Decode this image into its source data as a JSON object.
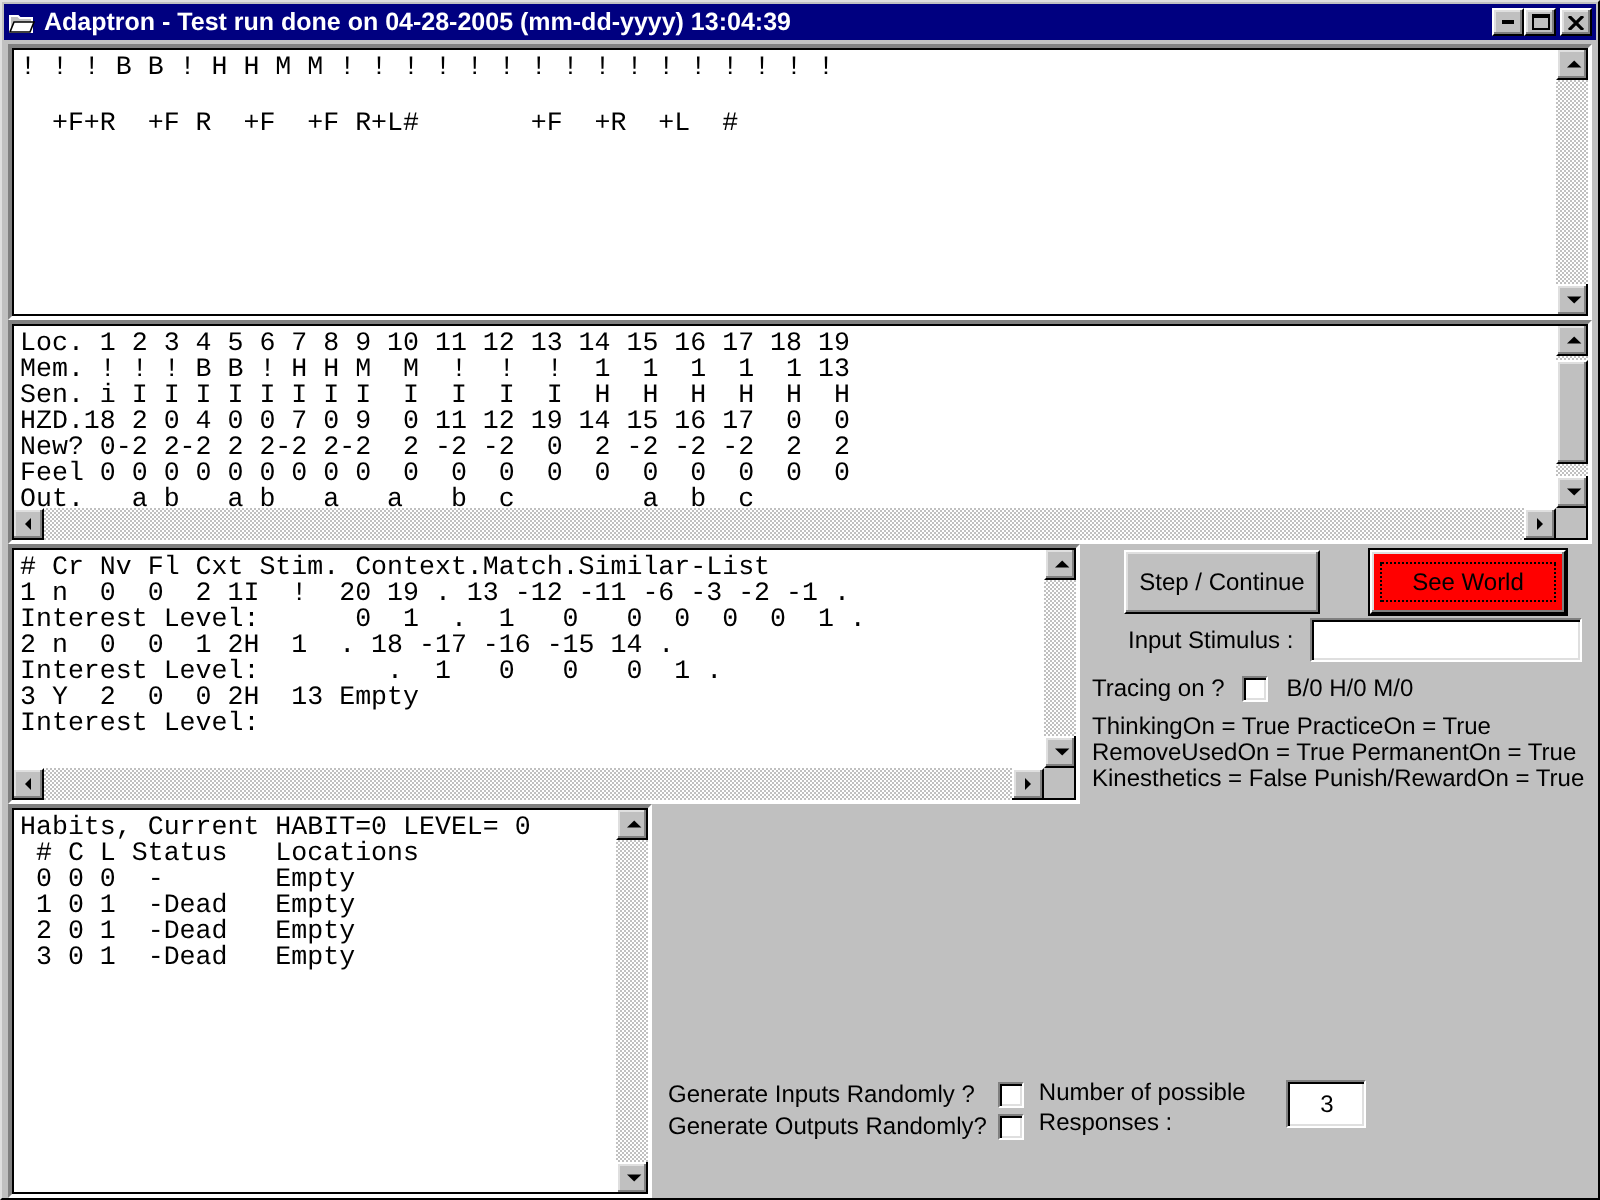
{
  "window": {
    "title": "Adaptron - Test run done on 04-28-2005 (mm-dd-yyyy) 13:04:39"
  },
  "stimulus_pane": {
    "lines": [
      "! ! ! B B ! H H M M ! ! ! ! ! ! ! ! ! ! ! ! ! ! ! !",
      "  +F+R  +F R  +F  +F R+L#       +F  +R  +L  #"
    ]
  },
  "memory_table": {
    "lines": [
      "Loc. 1 2 3 4 5 6 7 8 9 10 11 12 13 14 15 16 17 18 19",
      "Mem. ! ! ! B B ! H H M  M  !  !  !  1  1  1  1  1 13",
      "Sen. i I I I I I I I I  I  I  I  I  H  H  H  H  H  H",
      "HZD.18 2 0 4 0 0 7 0 9  0 11 12 19 14 15 16 17  0  0",
      "New? 0-2 2-2 2 2-2 2-2  2 -2 -2  0  2 -2 -2 -2  2  2",
      "Feel 0 0 0 0 0 0 0 0 0  0  0  0  0  0  0  0  0  0  0",
      "Out.   a b   a b   a   a   b  c        a  b  c"
    ]
  },
  "context_pane": {
    "lines": [
      "# Cr Nv Fl Cxt Stim. Context.Match.Similar-List",
      "1 n  0  0  2 1I  !  20 19 . 13 -12 -11 -6 -3 -2 -1 .",
      "Interest Level:      0  1  .  1   0   0  0  0  0  1 .",
      "2 n  0  0  1 2H  1  . 18 -17 -16 -15 14 .",
      "Interest Level:        .  1   0   0   0  1 .",
      "3 Y  2  0  0 2H  13 Empty",
      "Interest Level:"
    ]
  },
  "buttons": [
    {
      "label": "Step / Continue",
      "kind": "normal",
      "focused": false
    },
    {
      "label": "See World",
      "kind": "alert",
      "focused": true
    }
  ],
  "input_stimulus": {
    "label": "Input Stimulus :"
  },
  "tracing": {
    "label": "Tracing on ?",
    "checked": false,
    "counts": "B/0  H/0  M/0"
  },
  "settings": [
    "ThinkingOn = True PracticeOn = True",
    "RemoveUsedOn = True PermanentOn = True",
    "Kinesthetics = False Punish/RewardOn = True"
  ],
  "habits_pane": {
    "lines": [
      "Habits, Current HABIT=0 LEVEL= 0",
      " # C L Status   Locations",
      " 0 0 0  -       Empty",
      " 1 0 1  -Dead   Empty",
      " 2 0 1  -Dead   Empty",
      " 3 0 1  -Dead   Empty"
    ]
  },
  "random_options": [
    {
      "label": "Generate Inputs Randomly ?",
      "checked": false
    },
    {
      "label": "Generate Outputs Randomly?",
      "checked": false
    }
  ],
  "responses": {
    "label": "Number of possible Responses :",
    "value": "3"
  }
}
